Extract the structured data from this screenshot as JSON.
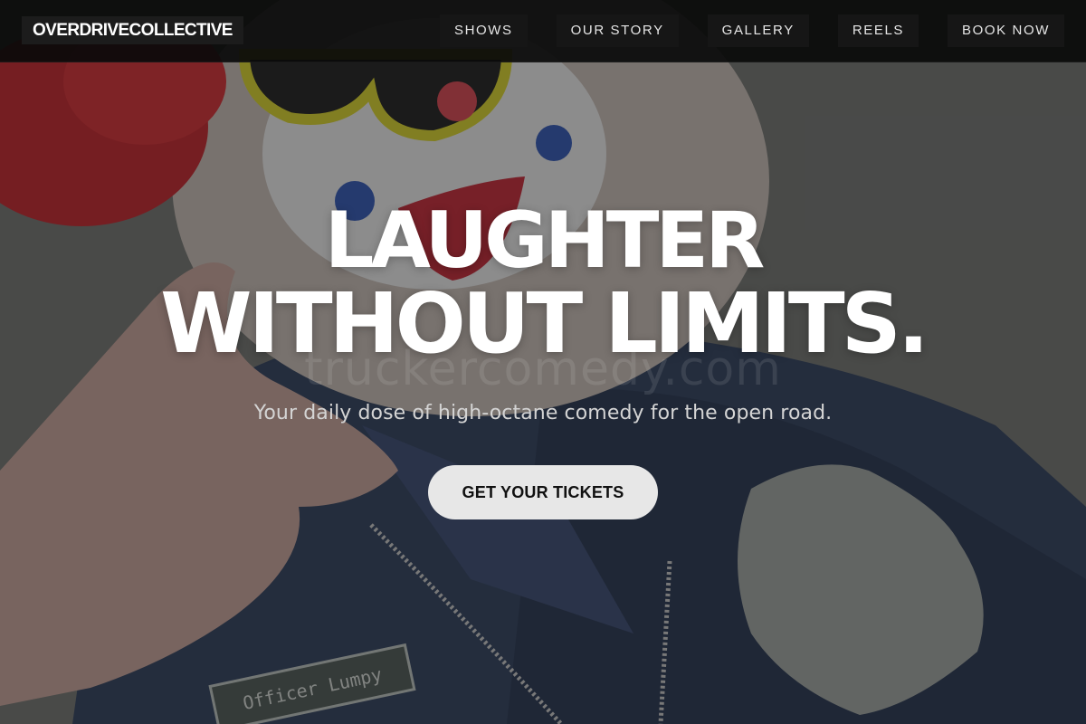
{
  "brand": {
    "name": "OVERDRIVECOLLECTIVE"
  },
  "nav": {
    "items": [
      {
        "label": "SHOWS"
      },
      {
        "label": "OUR STORY"
      },
      {
        "label": "GALLERY"
      },
      {
        "label": "REELS"
      },
      {
        "label": "BOOK NOW"
      }
    ]
  },
  "hero": {
    "title_line1": "LAUGHTER",
    "title_line2": "WITHOUT LIMITS.",
    "watermark": "truckercomedy.com",
    "subtitle": "Your daily dose of high-octane comedy for the open road.",
    "cta_label": "GET YOUR TICKETS",
    "name_tag": "Officer Lumpy"
  },
  "colors": {
    "navbar_bg": "#0a0a0a",
    "cta_bg": "#e7e7e7",
    "text": "#ffffff"
  }
}
